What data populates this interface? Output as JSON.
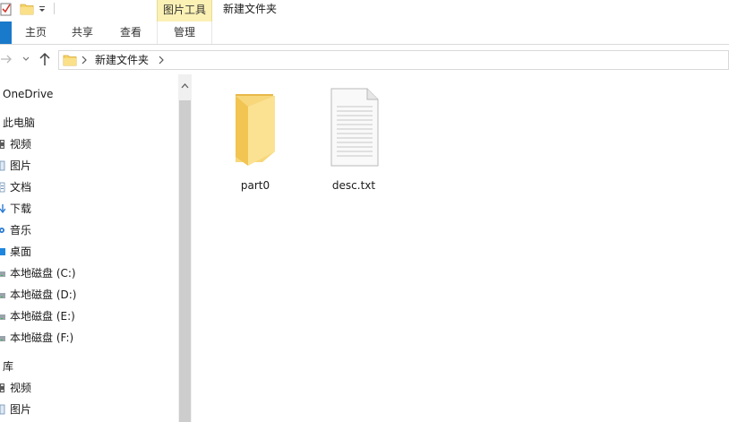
{
  "titlebar": {
    "context_tab_group": "图片工具",
    "window_title": "新建文件夹",
    "icons": {
      "properties": "check-properties-icon",
      "new_folder": "new-folder-icon",
      "customize": "customize-dropdown-icon"
    }
  },
  "ribbon": {
    "tabs": [
      {
        "label": "主页"
      },
      {
        "label": "共享"
      },
      {
        "label": "查看"
      },
      {
        "label": "管理"
      }
    ],
    "file_tab_color": "#1979ca",
    "context_color": "#fbf1b5"
  },
  "address": {
    "crumbs": [
      "新建文件夹"
    ],
    "icons": {
      "forward": "forward-arrow-icon",
      "recent": "recent-chevron-icon",
      "up": "up-arrow-icon"
    }
  },
  "nav": {
    "onedrive": "OneDrive",
    "this_pc": "此电脑",
    "pc_items": [
      {
        "label": "视频",
        "icon": "video-icon"
      },
      {
        "label": "图片",
        "icon": "pictures-icon"
      },
      {
        "label": "文档",
        "icon": "documents-icon"
      },
      {
        "label": "下载",
        "icon": "download-icon"
      },
      {
        "label": "音乐",
        "icon": "music-icon"
      },
      {
        "label": "桌面",
        "icon": "desktop-icon"
      },
      {
        "label": "本地磁盘 (C:)",
        "icon": "drive-icon"
      },
      {
        "label": "本地磁盘 (D:)",
        "icon": "drive-icon"
      },
      {
        "label": "本地磁盘 (E:)",
        "icon": "drive-icon"
      },
      {
        "label": "本地磁盘 (F:)",
        "icon": "drive-icon"
      }
    ],
    "library": "库",
    "library_items": [
      {
        "label": "视频",
        "icon": "video-icon"
      },
      {
        "label": "图片",
        "icon": "pictures-icon"
      }
    ]
  },
  "files": [
    {
      "name": "part0",
      "type": "folder"
    },
    {
      "name": "desc.txt",
      "type": "text-document"
    }
  ]
}
